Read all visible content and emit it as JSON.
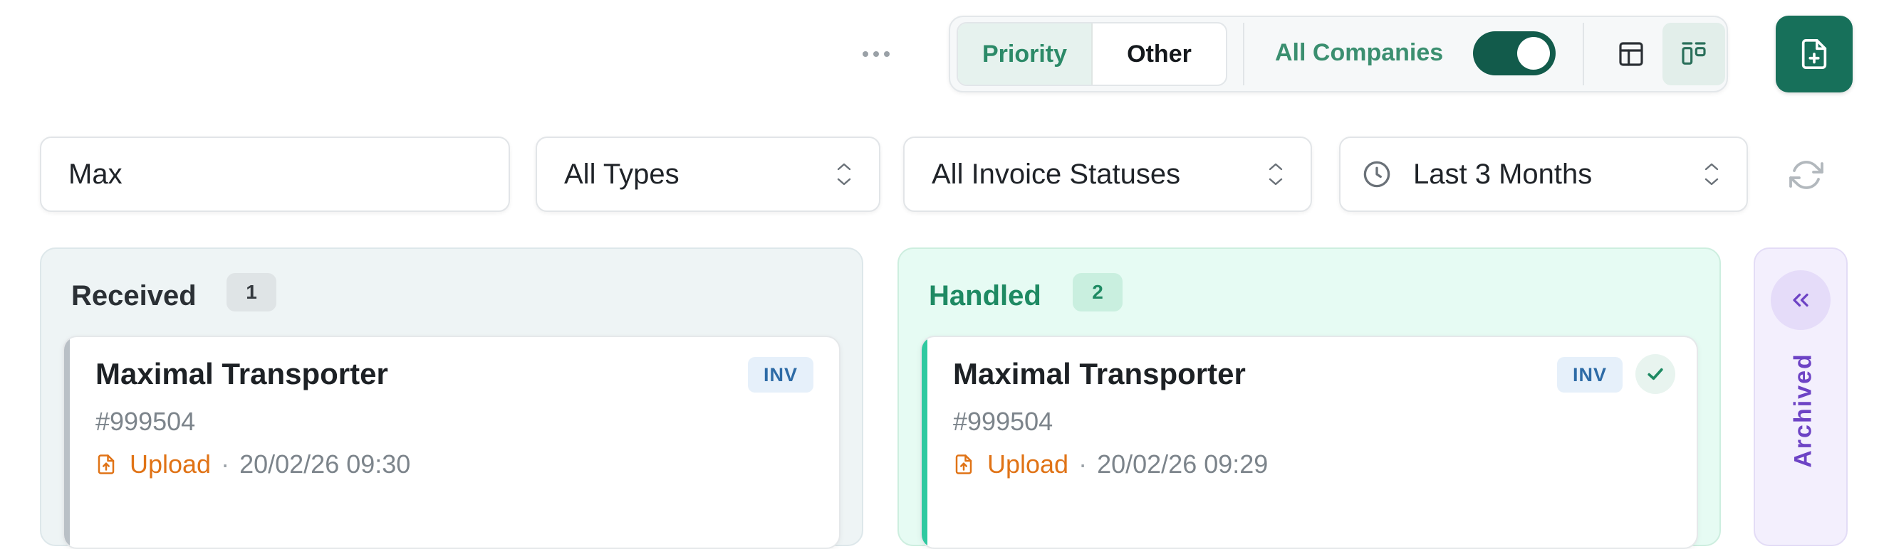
{
  "toolbar": {
    "more_icon": "more-horizontal-icon",
    "priority_label": "Priority",
    "other_label": "Other",
    "companies_label": "All Companies",
    "companies_toggle_on": true,
    "table_view_icon": "table-icon",
    "board_view_icon": "kanban-icon",
    "active_view": "board",
    "new_document_icon": "file-plus-icon"
  },
  "filters": {
    "search_value": "Max",
    "type_select": "All Types",
    "status_select": "All Invoice Statuses",
    "date_icon": "clock-icon",
    "date_select": "Last 3 Months",
    "refresh_icon": "refresh-icon"
  },
  "columns": {
    "received": {
      "title": "Received",
      "count": "1",
      "cards": [
        {
          "title": "Maximal Transporter",
          "id": "#999504",
          "source": "Upload",
          "separator": "·",
          "time": "20/02/26 09:30",
          "badge": "INV"
        }
      ]
    },
    "handled": {
      "title": "Handled",
      "count": "2",
      "cards": [
        {
          "title": "Maximal Transporter",
          "id": "#999504",
          "source": "Upload",
          "separator": "·",
          "time": "20/02/26 09:29",
          "badge": "INV",
          "status_icon": "check-icon"
        }
      ]
    },
    "archived": {
      "title": "Archived",
      "collapse_icon": "chevrons-left-icon"
    }
  },
  "colors": {
    "brand": "#17705a",
    "accent": "#2c8a68",
    "toggle": "#125b4b",
    "handled_accent": "#2fc9a0",
    "upload": "#e07316",
    "archived": "#6d43c5"
  }
}
